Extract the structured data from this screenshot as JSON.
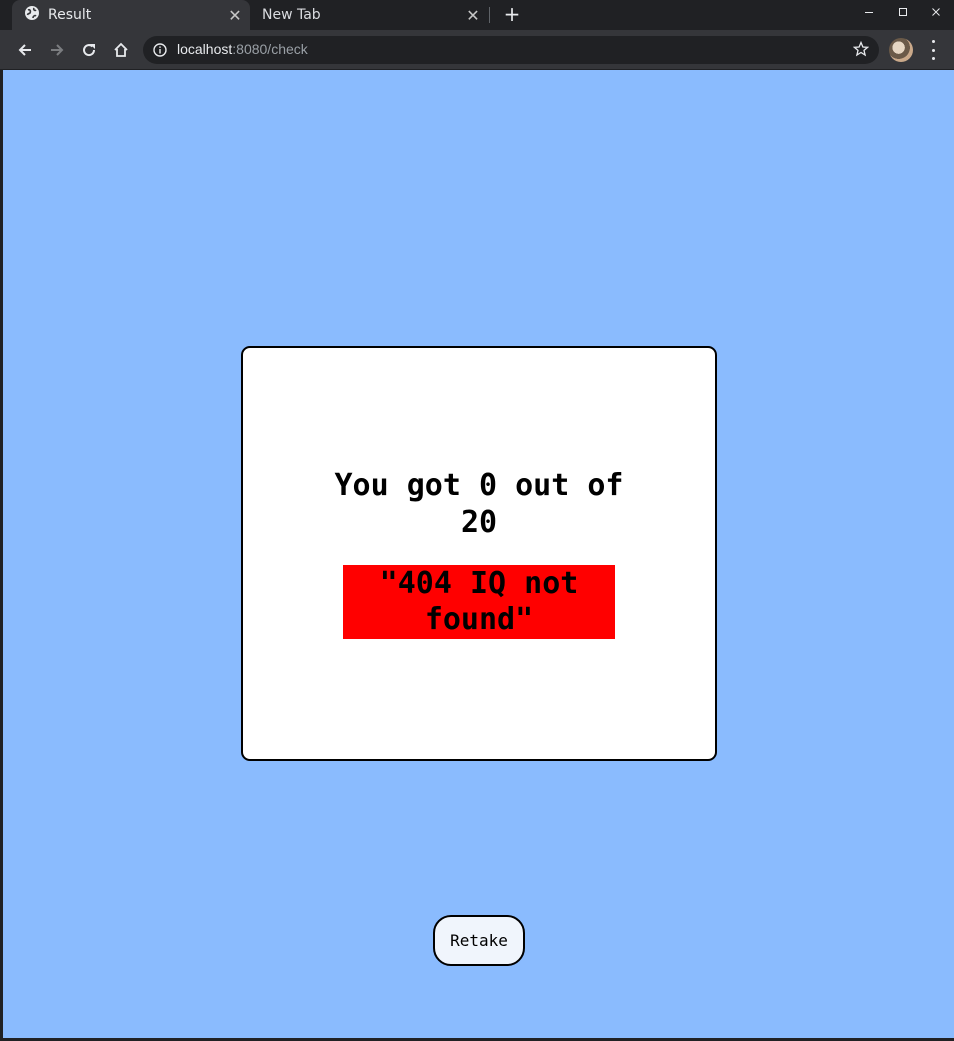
{
  "browser": {
    "tabs": [
      {
        "title": "Result",
        "active": true,
        "icon": "globe-icon"
      },
      {
        "title": "New Tab",
        "active": false
      }
    ],
    "url_host": "localhost",
    "url_rest": ":8080/check"
  },
  "result": {
    "score_text": "You got 0 out of 20",
    "verdict_text": "\"404 IQ not found\"",
    "retake_label": "Retake"
  },
  "colors": {
    "page_background": "#8abbfe",
    "card_background": "#ffffff",
    "verdict_background": "#ff0000",
    "button_background": "#f0f5fc"
  }
}
